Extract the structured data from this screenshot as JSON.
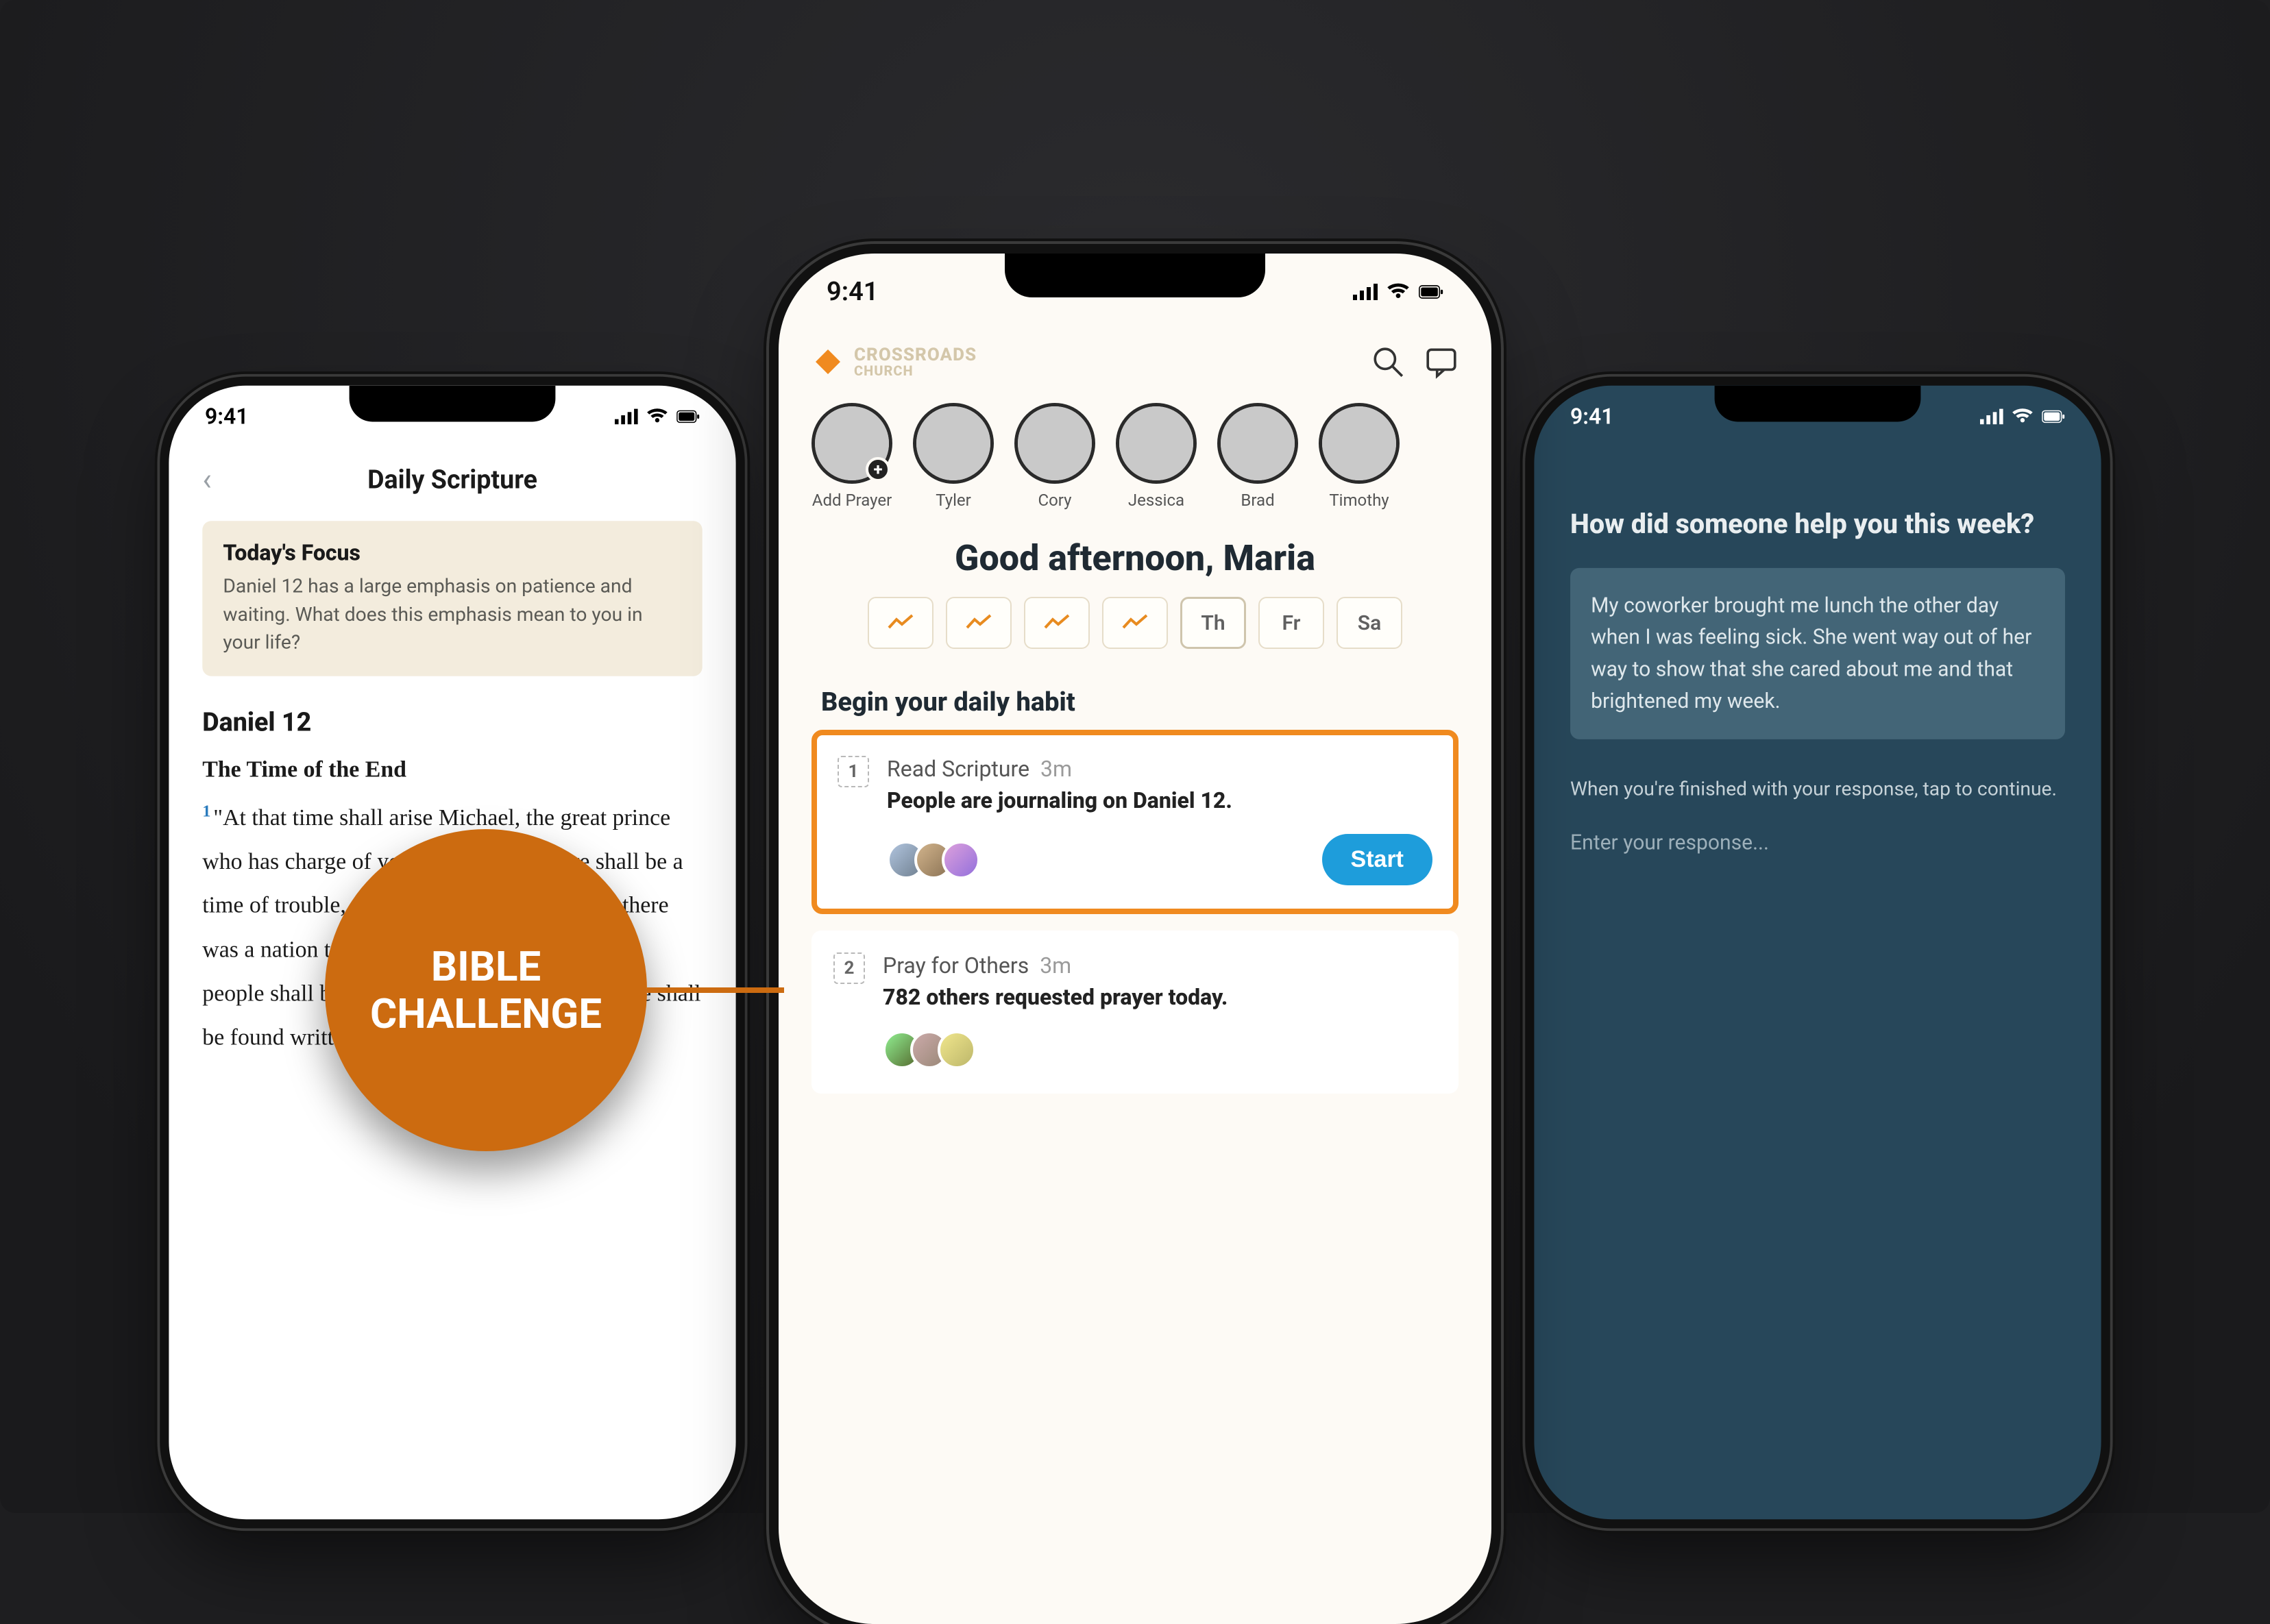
{
  "status": {
    "time": "9:41"
  },
  "left": {
    "title": "Daily Scripture",
    "focus_heading": "Today's Focus",
    "focus_body": "Daniel 12 has a large emphasis on patience and waiting. What does this emphasis mean to you in your life?",
    "chapter": "Daniel 12",
    "subhead": "The Time of the End",
    "verse": "\"At that time shall arise Michael, the great prince who has charge of your people. And there shall be a time of trouble, such as never has been since there was a nation till that time. But at that time your people shall be delivered, everyone whose name shall be found written in the book."
  },
  "center": {
    "brand_line1": "CROSSROADS",
    "brand_line2": "CHURCH",
    "stories": [
      {
        "label": "Add Prayer",
        "has_plus": true
      },
      {
        "label": "Tyler"
      },
      {
        "label": "Cory"
      },
      {
        "label": "Jessica"
      },
      {
        "label": "Brad"
      },
      {
        "label": "Timothy"
      }
    ],
    "greeting": "Good afternoon, Maria",
    "days": [
      "",
      "",
      "",
      "",
      "Th",
      "Fr",
      "Sa"
    ],
    "habit_heading": "Begin your daily habit",
    "habits": [
      {
        "step": "1",
        "title": "Read Scripture",
        "dur": "3m",
        "line2": "People are journaling on Daniel 12.",
        "cta": "Start"
      },
      {
        "step": "2",
        "title": "Pray for Others",
        "dur": "3m",
        "line2": "782 others requested prayer today."
      }
    ]
  },
  "right": {
    "question": "How did someone help you this week?",
    "card_body": "My coworker brought me lunch the other day when I was feeling sick. She went way out of her way to show that she cared about me and that brightened my week.",
    "hint": "When you're finished with your response, tap to continue.",
    "input_ph": "Enter your response..."
  },
  "callout": {
    "line1": "BIBLE",
    "line2": "CHALLENGE"
  }
}
